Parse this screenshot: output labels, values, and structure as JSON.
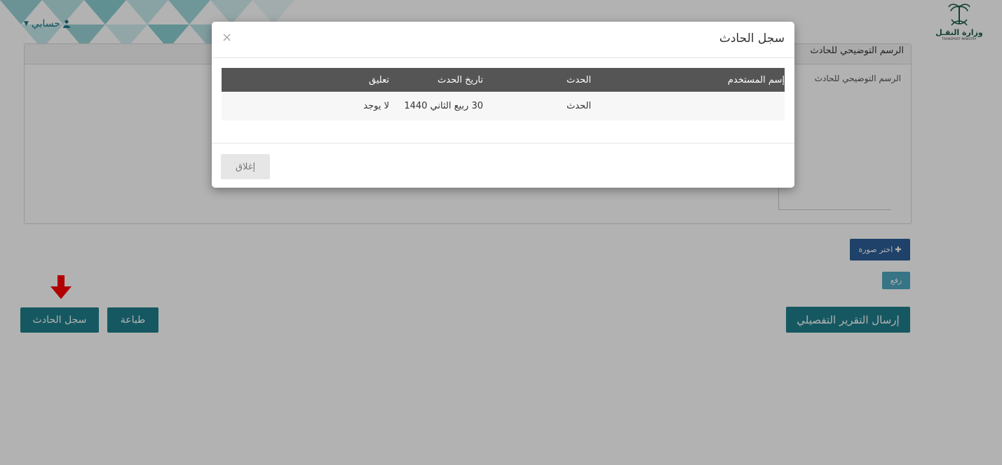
{
  "header": {
    "account_label": "حسابي",
    "logo_text": "وزارة النقـل",
    "logo_sub": "TRANSPORT MINISTRY"
  },
  "panel": {
    "title": "الرسم التوضيحي للحادث",
    "field_label": "الرسم التوضيحي للحادث"
  },
  "actions": {
    "choose_image": "اختر صورة",
    "upload": "رفع",
    "send_report": "إرسال التقرير التفصيلي",
    "print": "طباعة",
    "incident_log": "سجل الحادث"
  },
  "modal": {
    "title": "سجل الحادث",
    "close_symbol": "×",
    "columns": [
      "إسم المستخدم",
      "الحدث",
      "تاريخ الحدث",
      "تعليق"
    ],
    "rows": [
      {
        "user": "",
        "event": "الحدث",
        "date": "30 ربيع الثاني 1440",
        "comment": "لا يوجد"
      }
    ],
    "close_button": "إغلاق"
  },
  "colors": {
    "teal": "#1f7f8c",
    "blue": "#2b5f97",
    "table_header": "#555555",
    "arrow": "#ff0000"
  }
}
